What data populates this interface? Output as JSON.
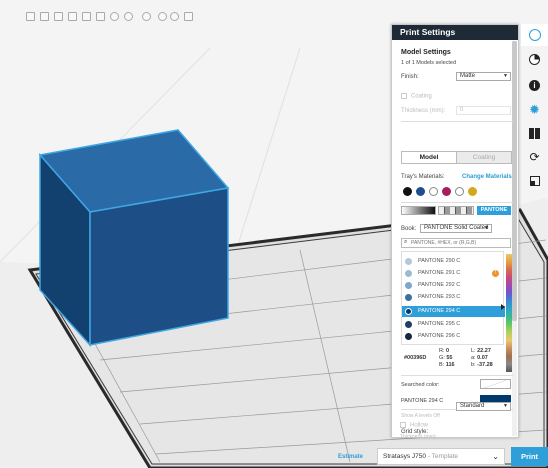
{
  "viewport": {
    "toolbar_count": 12
  },
  "panel": {
    "title": "Print Settings",
    "model_settings_title": "Model Settings",
    "models_selected": "1 of 1 Models selected",
    "finish_label": "Finish:",
    "finish_value": "Matte",
    "coating_label": "Coating",
    "thickness_label": "Thickness (mm):",
    "thickness_value": "0",
    "tab_model": "Model",
    "tab_coating": "Coating",
    "trays_materials_label": "Tray's Materials:",
    "change_materials_link": "Change Materials",
    "pantone_button": "PANTONE",
    "book_label": "Book:",
    "book_value": "PANTONE Solid Coated",
    "search_placeholder": "PANTONE, #HEX, or (R,G,B)",
    "color_list": [
      {
        "name": "PANTONE 290 C",
        "hex": "#b3c8da"
      },
      {
        "name": "PANTONE 291 C",
        "hex": "#9fb9d3"
      },
      {
        "name": "PANTONE 292 C",
        "hex": "#7fa6cc"
      },
      {
        "name": "PANTONE 293 C",
        "hex": "#3d6fa0"
      },
      {
        "name": "PANTONE 294 C",
        "hex": "#00396d"
      },
      {
        "name": "PANTONE 295 C",
        "hex": "#1f3f66"
      },
      {
        "name": "PANTONE 296 C",
        "hex": "#14273f"
      }
    ],
    "selected_color_name": "PANTONE 294 C",
    "warning_badge": "!",
    "hex_value": "#00396D",
    "r_label": "R:",
    "r_value": "0",
    "g_label": "G:",
    "g_value": "55",
    "b_label": "B:",
    "b_value": "116",
    "l_label": "L:",
    "l_value": "22.27",
    "a_label": "a:",
    "a_value": "0.07",
    "bb_label": "b:",
    "bb_value": "-37.28",
    "searched_color_label": "Searched color:",
    "result_color_label": "PANTONE 294 C",
    "show_all_label": "Show A levels Off",
    "grid_style_label": "Grid style:",
    "grid_style_value": "Standard",
    "hollow_label": "Hollow",
    "bottom_thickness_label": "Thickness (mm):"
  },
  "colors": {
    "accent": "#2e9fd8",
    "model_blue": "#1f4e80",
    "selected_row": "#2e9fd8",
    "header_dark": "#1e2b36",
    "selected_swatch": "#00396d"
  },
  "tray_swatches": [
    "#111111",
    "#1f4e8f",
    "#ffffff",
    "#a81d5c",
    "#ffffff",
    "#d4a81b"
  ],
  "right_icons": [
    "globe-icon",
    "pie-icon",
    "info-icon",
    "gear-icon",
    "layout-icon",
    "refresh-icon",
    "resize-icon"
  ],
  "bottom_bar": {
    "estimate": "Estimate",
    "printer": "Stratasys J750",
    "template": "Template",
    "print_button": "Print"
  }
}
